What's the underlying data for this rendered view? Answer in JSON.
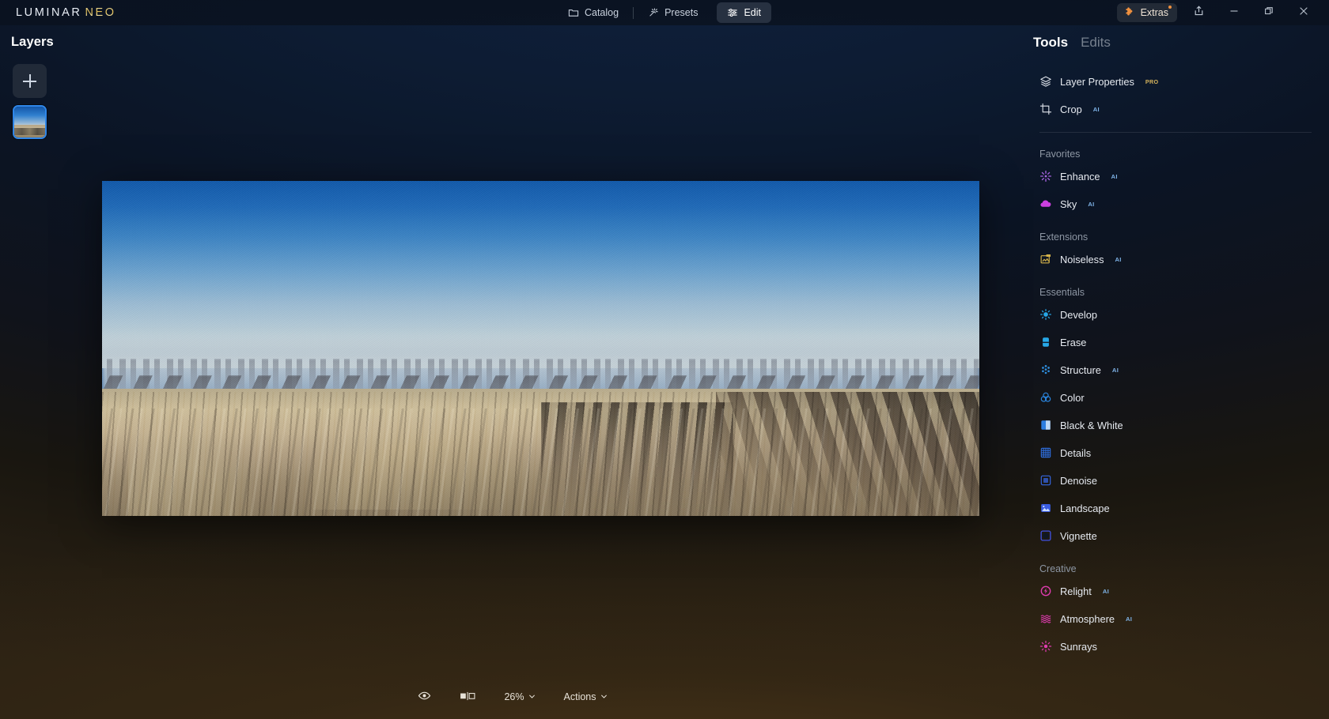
{
  "app": {
    "logo_primary": "LUMINAR",
    "logo_secondary": "NEO"
  },
  "titlebar": {
    "nav": [
      {
        "label": "Catalog",
        "icon": "folder-icon",
        "active": false
      },
      {
        "label": "Presets",
        "icon": "magic-wand-icon",
        "active": false
      },
      {
        "label": "Edit",
        "icon": "sliders-icon",
        "active": true
      }
    ],
    "extras_label": "Extras",
    "extras_icon": "puzzle-piece-icon",
    "extras_badge": true,
    "share_icon": "share-icon",
    "window_controls": [
      {
        "name": "minimize-button",
        "glyph": "minimize-icon"
      },
      {
        "name": "maximize-button",
        "glyph": "restore-icon"
      },
      {
        "name": "close-button",
        "glyph": "close-icon"
      }
    ]
  },
  "layers": {
    "title": "Layers",
    "add_icon": "plus-icon",
    "thumbnail_alt": "desert-canyon-layer-thumbnail"
  },
  "bottombar": {
    "preview_icon": "eye-icon",
    "compare_icon": "compare-split-icon",
    "zoom_value": "26%",
    "zoom_chevron": "chevron-down-icon",
    "actions_label": "Actions",
    "actions_chevron": "chevron-down-icon"
  },
  "tools": {
    "tabs": [
      {
        "label": "Tools",
        "active": true
      },
      {
        "label": "Edits",
        "active": false
      }
    ],
    "top_items": [
      {
        "label": "Layer Properties",
        "badge": "PRO",
        "badge_type": "pro",
        "icon": "layers-stack-icon",
        "color": "#e3e8ef"
      },
      {
        "label": "Crop",
        "badge": "AI",
        "badge_type": "ai",
        "icon": "crop-icon",
        "color": "#e3e8ef"
      }
    ],
    "sections": [
      {
        "title": "Favorites",
        "items": [
          {
            "label": "Enhance",
            "badge": "AI",
            "badge_type": "ai",
            "icon": "sparkle-icon",
            "color": "#a663e0"
          },
          {
            "label": "Sky",
            "badge": "AI",
            "badge_type": "ai",
            "icon": "cloud-icon",
            "color": "#cc3fe0"
          }
        ]
      },
      {
        "title": "Extensions",
        "items": [
          {
            "label": "Noiseless",
            "badge": "AI",
            "badge_type": "ai",
            "icon": "noiseless-pro-icon",
            "color": "#d4b24a"
          }
        ]
      },
      {
        "title": "Essentials",
        "items": [
          {
            "label": "Develop",
            "badge": "",
            "badge_type": "",
            "icon": "sun-icon",
            "color": "#27a8e8"
          },
          {
            "label": "Erase",
            "badge": "",
            "badge_type": "",
            "icon": "eraser-icon",
            "color": "#27a8e8"
          },
          {
            "label": "Structure",
            "badge": "AI",
            "badge_type": "ai",
            "icon": "dots-cluster-icon",
            "color": "#2e8fe0"
          },
          {
            "label": "Color",
            "badge": "",
            "badge_type": "",
            "icon": "venn-circles-icon",
            "color": "#2a86e0"
          },
          {
            "label": "Black & White",
            "badge": "",
            "badge_type": "",
            "icon": "split-square-icon",
            "color": "#2c7ee0"
          },
          {
            "label": "Details",
            "badge": "",
            "badge_type": "",
            "icon": "grid-icon",
            "color": "#2f6fe0"
          },
          {
            "label": "Denoise",
            "badge": "",
            "badge_type": "",
            "icon": "rounded-square-icon",
            "color": "#3566e0"
          },
          {
            "label": "Landscape",
            "badge": "",
            "badge_type": "",
            "icon": "mountain-photo-icon",
            "color": "#3a5ce0"
          },
          {
            "label": "Vignette",
            "badge": "",
            "badge_type": "",
            "icon": "vignette-icon",
            "color": "#4050e0"
          }
        ]
      },
      {
        "title": "Creative",
        "items": [
          {
            "label": "Relight",
            "badge": "AI",
            "badge_type": "ai",
            "icon": "lightning-circle-icon",
            "color": "#e03cb0"
          },
          {
            "label": "Atmosphere",
            "badge": "AI",
            "badge_type": "ai",
            "icon": "waves-icon",
            "color": "#e03cb0"
          },
          {
            "label": "Sunrays",
            "badge": "",
            "badge_type": "",
            "icon": "sunburst-icon",
            "color": "#e03cb0"
          }
        ]
      }
    ]
  }
}
